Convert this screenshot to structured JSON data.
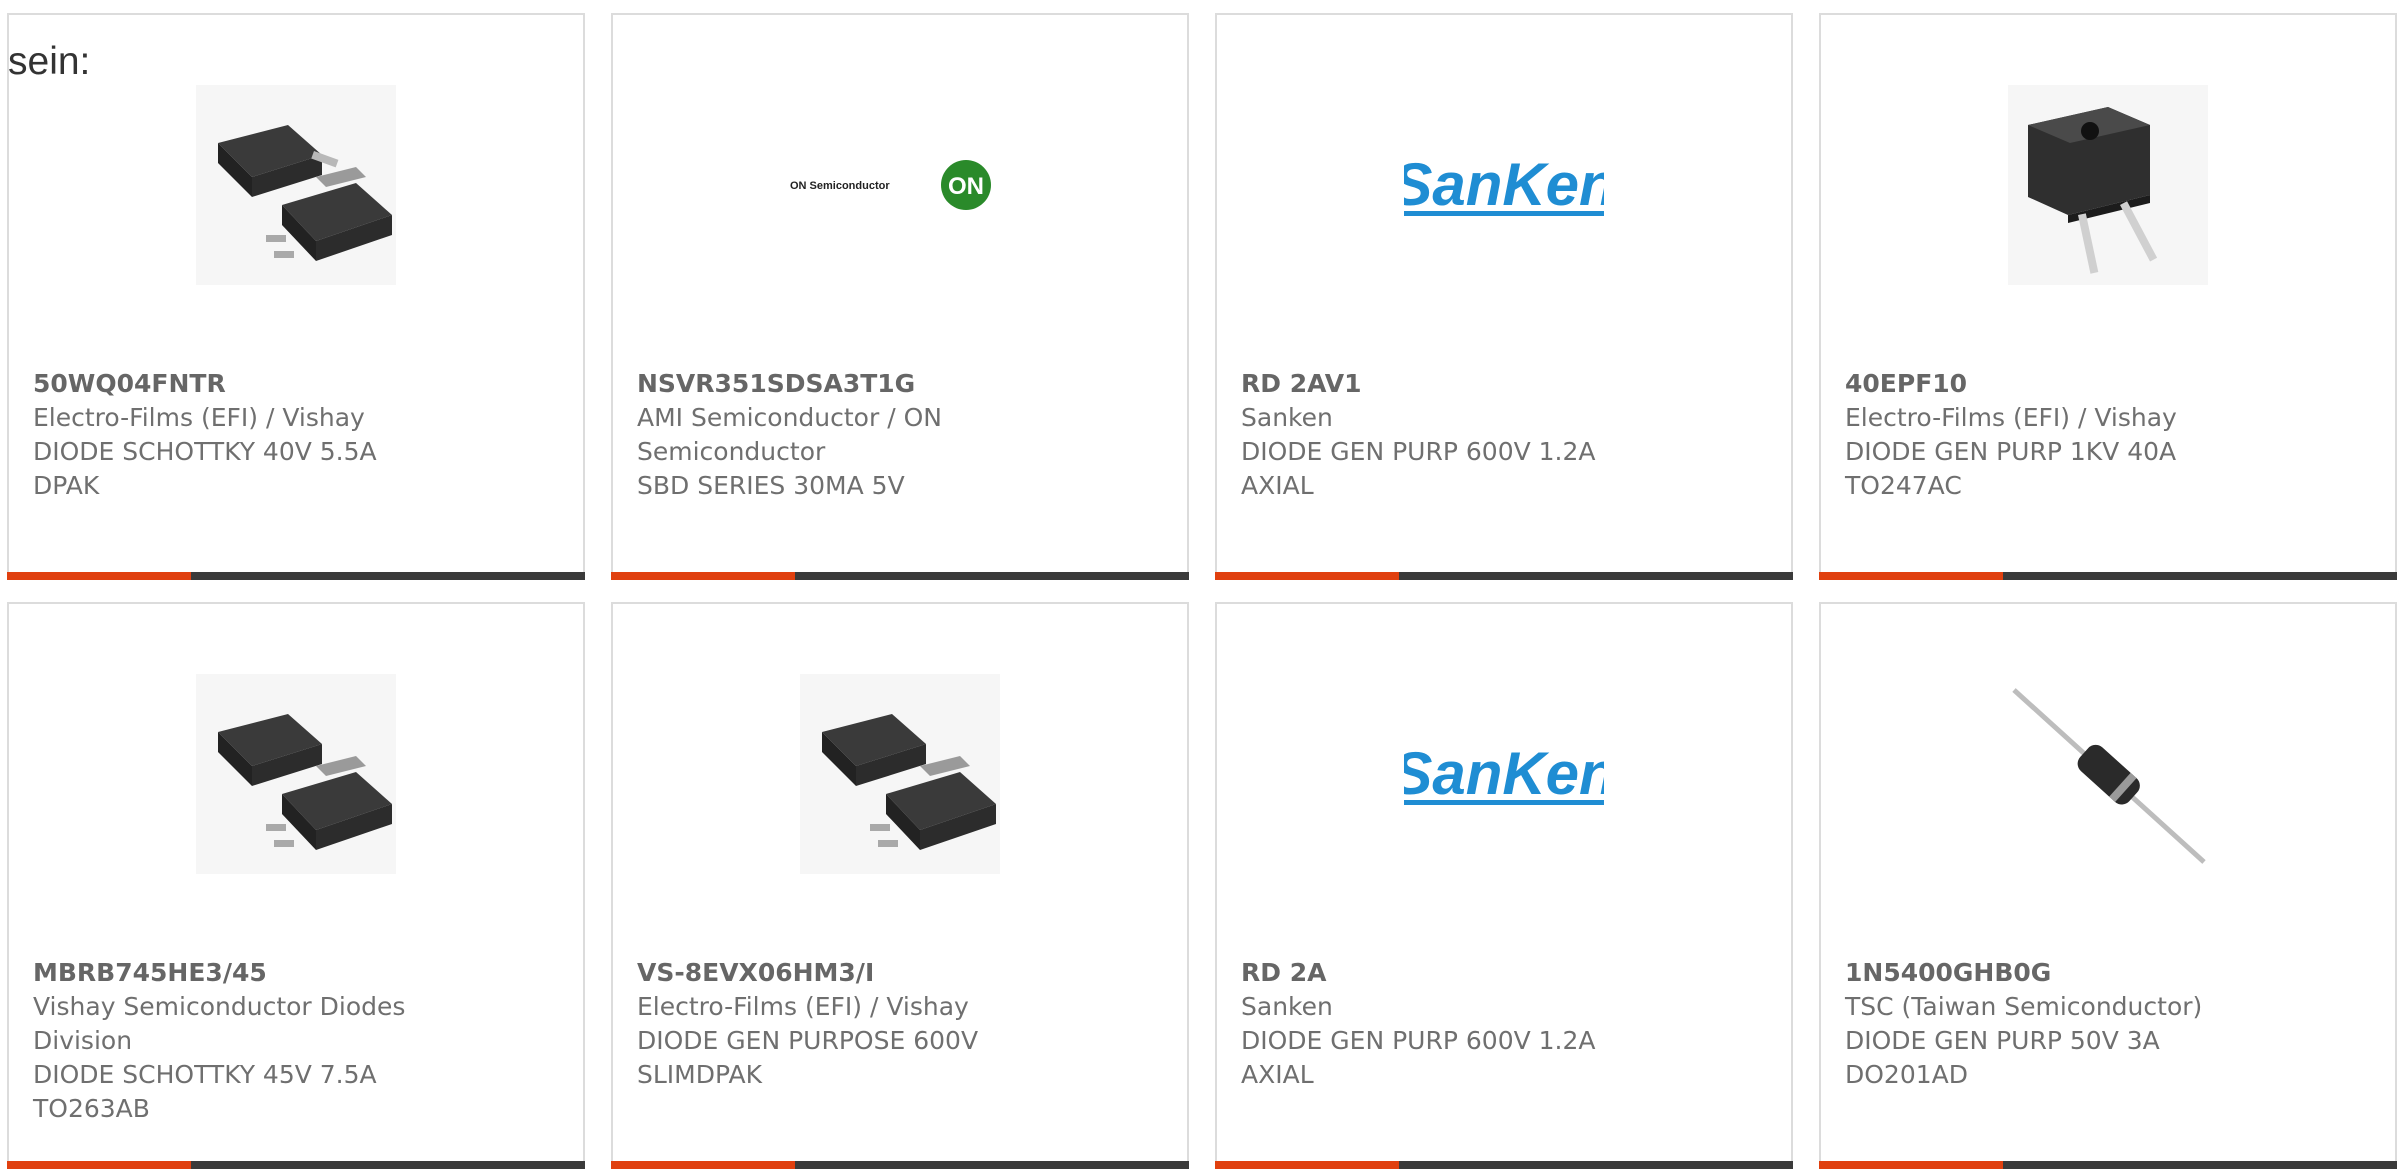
{
  "intro_text": "sein:",
  "colors": {
    "accent": "#e0400f",
    "bar": "#3a3a3a",
    "sanken_blue": "#1f8dd3",
    "on_green": "#2a8a2a"
  },
  "cards": [
    {
      "part_number": "50WQ04FNTR",
      "manufacturer": "Electro-Films (EFI) / Vishay",
      "desc1": "DIODE SCHOTTKY 40V 5.5A",
      "desc2": "DPAK",
      "image": "dpak-package-image"
    },
    {
      "part_number": "NSVR351SDSA3T1G",
      "manufacturer": "AMI Semiconductor / ON",
      "manufacturer2": "Semiconductor",
      "desc1": "SBD SERIES 30MA 5V",
      "image": "on-semiconductor-logo",
      "logo_text": "ON Semiconductor",
      "logo_badge": "ON"
    },
    {
      "part_number": "RD 2AV1",
      "manufacturer": "Sanken",
      "desc1": "DIODE GEN PURP 600V 1.2A",
      "desc2": "AXIAL",
      "image": "sanken-logo",
      "logo_text": "SanKen"
    },
    {
      "part_number": "40EPF10",
      "manufacturer": "Electro-Films (EFI) / Vishay",
      "desc1": "DIODE GEN PURP 1KV 40A",
      "desc2": "TO247AC",
      "image": "to247-package-image"
    },
    {
      "part_number": "MBRB745HE3/45",
      "manufacturer": "Vishay Semiconductor Diodes",
      "manufacturer2": "Division",
      "desc1": "DIODE SCHOTTKY 45V 7.5A",
      "desc2": "TO263AB",
      "image": "dpak-package-image"
    },
    {
      "part_number": "VS-8EVX06HM3/I",
      "manufacturer": "Electro-Films (EFI) / Vishay",
      "desc1": "DIODE GEN PURPOSE 600V",
      "desc2": "SLIMDPAK",
      "image": "dpak-package-image"
    },
    {
      "part_number": "RD 2A",
      "manufacturer": "Sanken",
      "desc1": "DIODE GEN PURP 600V 1.2A",
      "desc2": "AXIAL",
      "image": "sanken-logo",
      "logo_text": "SanKen"
    },
    {
      "part_number": "1N5400GHB0G",
      "manufacturer": "TSC (Taiwan Semiconductor)",
      "desc1": "DIODE GEN PURP 50V 3A",
      "desc2": "DO201AD",
      "image": "axial-diode-image"
    }
  ]
}
